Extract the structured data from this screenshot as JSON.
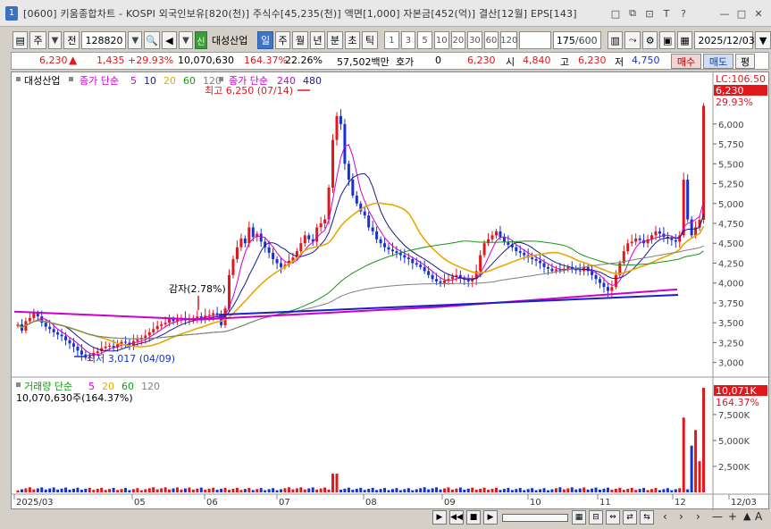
{
  "window": {
    "number": "1",
    "title": "[0600] 키움종합차트 - KOSPI 외국인보유[820(천)] 주식수[45,235(천)] 액면[1,000] 자본금[452(억)] 결산[12월] EPS[143]",
    "buttons": [
      "□",
      "⧉",
      "⊡",
      "T",
      "?",
      "—",
      "□",
      "✕"
    ]
  },
  "toolbar": {
    "period": "주",
    "prev_label": "전",
    "code": "128820",
    "shin": "신",
    "stock_name": "대성산업",
    "intervals": [
      "일",
      "주",
      "월",
      "년",
      "분",
      "초",
      "틱"
    ],
    "active_interval": "일",
    "nums": [
      "1",
      "3",
      "5",
      "10",
      "20",
      "30",
      "60",
      "120"
    ],
    "count": "175",
    "count_total": "/600",
    "date": "2025/12/03"
  },
  "quote": {
    "price": "6,230",
    "change": "1,435",
    "change_pct": "+29.93%",
    "volume": "10,070,630",
    "vol_ratio": "164.37%",
    "turnover": "22.26%",
    "amount": "57,502백만",
    "hoga_label": "호가",
    "hoga_val": "0",
    "hoga_price": "6,230",
    "open_label": "시",
    "open": "4,840",
    "high_label": "고",
    "high": "6,230",
    "low_label": "저",
    "low": "4,750",
    "buy": "매수",
    "sell": "매도",
    "flat": "평"
  },
  "legend": {
    "stock": "대성산업",
    "ma_label": "종가 단순",
    "ma_periods": [
      "5",
      "10",
      "20",
      "60",
      "120"
    ],
    "ma2_label": "종가 단순",
    "ma2_periods": [
      "240",
      "480"
    ],
    "vol_label": "거래량 단순",
    "vol_periods": [
      "5",
      "20",
      "60",
      "120"
    ],
    "vol_value": "10,070,630주(164.37%)"
  },
  "annotations": {
    "high": "최고 6,250 (07/14)",
    "low": "최저 3,017 (04/09)",
    "adj": "감자(2.78%)",
    "lc": "LC:106.50",
    "cur_price": "6,230",
    "cur_pct": "29.93%",
    "cur_vol": "10,071K",
    "cur_vol_pct": "164.37%"
  },
  "colors": {
    "up": "#e0181c",
    "down": "#1632d2",
    "ma5": "#d000d0",
    "ma10": "#1a1a8c",
    "ma20": "#e8a800",
    "ma60": "#149614",
    "ma120": "#808080",
    "ma240": "#cc00cc",
    "trend": "#1a20c8"
  },
  "chart_data": {
    "type": "candlestick",
    "y_ticks": [
      "6,000",
      "5,750",
      "5,500",
      "5,250",
      "5,000",
      "4,750",
      "4,500",
      "4,250",
      "4,000",
      "3,750",
      "3,500",
      "3,250",
      "3,000"
    ],
    "ylim": [
      2850,
      6560
    ],
    "vol_ticks": [
      "7,500K",
      "5,000K",
      "2,500K"
    ],
    "vol_ylim": [
      0,
      10500
    ],
    "x_labels": [
      "2025/03",
      "05",
      "06",
      "07",
      "08",
      "09",
      "10",
      "11",
      "12",
      "12/03"
    ],
    "series_close": [
      3480,
      3400,
      3520,
      3560,
      3620,
      3580,
      3500,
      3450,
      3420,
      3380,
      3350,
      3330,
      3280,
      3240,
      3200,
      3150,
      3100,
      3060,
      3080,
      3120,
      3140,
      3180,
      3200,
      3210,
      3190,
      3230,
      3260,
      3250,
      3220,
      3270,
      3290,
      3310,
      3340,
      3380,
      3420,
      3460,
      3480,
      3500,
      3550,
      3520,
      3540,
      3560,
      3530,
      3550,
      3560,
      3580,
      3560,
      3590,
      3600,
      3620,
      3600,
      3470,
      3680,
      4100,
      4300,
      4450,
      4560,
      4500,
      4700,
      4580,
      4620,
      4520,
      4450,
      4380,
      4300,
      4250,
      4200,
      4230,
      4280,
      4320,
      4400,
      4500,
      4600,
      4550,
      4520,
      4700,
      4750,
      4800,
      5200,
      5800,
      6100,
      6000,
      5500,
      5300,
      5100,
      5000,
      4900,
      4850,
      4700,
      4650,
      4550,
      4500,
      4450,
      4420,
      4400,
      4380,
      4350,
      4320,
      4300,
      4250,
      4230,
      4200,
      4150,
      4100,
      4050,
      4020,
      4000,
      4030,
      4050,
      4080,
      4100,
      4060,
      4040,
      4020,
      4050,
      4150,
      4350,
      4500,
      4550,
      4600,
      4650,
      4580,
      4520,
      4480,
      4450,
      4400,
      4380,
      4350,
      4320,
      4300,
      4280,
      4250,
      4200,
      4180,
      4150,
      4170,
      4160,
      4180,
      4200,
      4170,
      4160,
      4150,
      4200,
      4150,
      4100,
      4050,
      4000,
      3950,
      3900,
      3950,
      4100,
      4250,
      4400,
      4500,
      4520,
      4560,
      4540,
      4500,
      4550,
      4600,
      4650,
      4620,
      4580,
      4560,
      4540,
      4520,
      4600,
      5300,
      4800,
      4600,
      4700,
      4795,
      6230
    ],
    "trend_line": [
      [
        3580,
        3600
      ],
      [
        3650,
        3850
      ]
    ],
    "ma240": [
      3640,
      3920
    ]
  }
}
